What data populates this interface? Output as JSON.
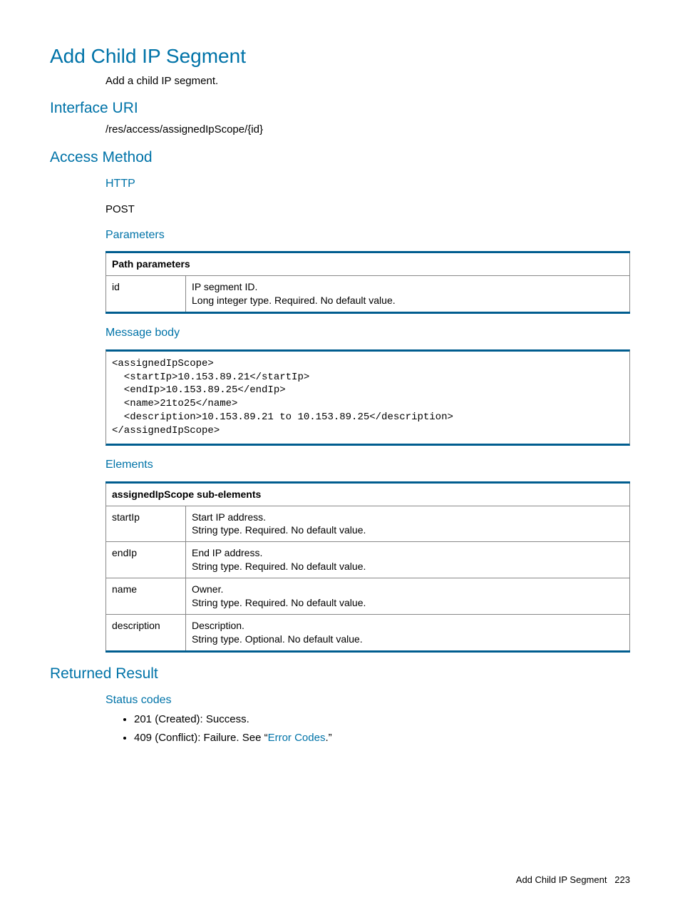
{
  "title": "Add Child IP Segment",
  "titleSub": "Add a child IP segment.",
  "interfaceUri": {
    "heading": "Interface URI",
    "value": "/res/access/assignedIpScope/{id}"
  },
  "accessMethod": {
    "heading": "Access Method",
    "httpHeading": "HTTP",
    "httpValue": "POST",
    "parametersHeading": "Parameters",
    "pathParamsHeader": "Path parameters",
    "pathParams": [
      {
        "name": "id",
        "line1": "IP segment ID.",
        "line2": "Long integer type. Required. No default value."
      }
    ],
    "messageBodyHeading": "Message body",
    "messageBodyCode": "<assignedIpScope>\n  <startIp>10.153.89.21</startIp>\n  <endIp>10.153.89.25</endIp>\n  <name>21to25</name>\n  <description>10.153.89.21 to 10.153.89.25</description>\n</assignedIpScope>",
    "elementsHeading": "Elements",
    "elementsHeader": "assignedIpScope sub-elements",
    "elements": [
      {
        "name": "startIp",
        "line1": "Start IP address.",
        "line2": "String type. Required. No default value."
      },
      {
        "name": "endIp",
        "line1": "End IP address.",
        "line2": "String type. Required. No default value."
      },
      {
        "name": "name",
        "line1": "Owner.",
        "line2": "String type. Required. No default value."
      },
      {
        "name": "description",
        "line1": "Description.",
        "line2": "String type. Optional. No default value."
      }
    ]
  },
  "returnedResult": {
    "heading": "Returned Result",
    "statusHeading": "Status codes",
    "statuses": [
      {
        "full": "201 (Created): Success."
      },
      {
        "prefix": "409 (Conflict): Failure. See “",
        "link": "Error Codes",
        "suffix": ".”"
      }
    ]
  },
  "footer": {
    "label": "Add Child IP Segment",
    "page": "223"
  }
}
